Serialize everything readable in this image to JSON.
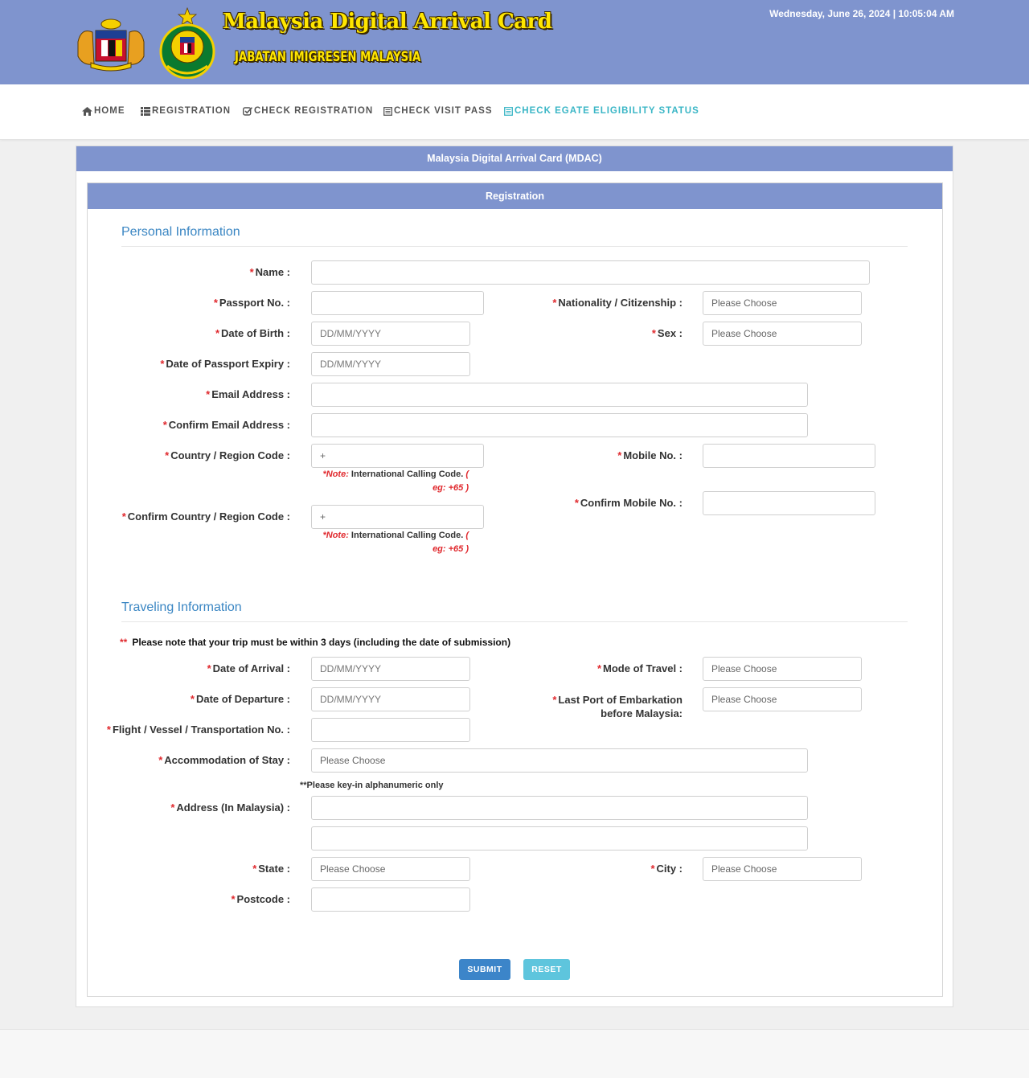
{
  "header": {
    "title": "Malaysia Digital Arrival Card",
    "subtitle": "JABATAN IMIGRESEN MALAYSIA",
    "datetime": "Wednesday, June 26, 2024 | 10:05:04 AM",
    "background_color": "#7f94ce",
    "emblems": [
      "coat-of-arms-emblem",
      "immigration-emblem"
    ]
  },
  "nav": {
    "items": [
      {
        "label": "HOME",
        "icon": "home-icon"
      },
      {
        "label": "REGISTRATION",
        "icon": "list-icon"
      },
      {
        "label": "CHECK REGISTRATION",
        "icon": "check-square-icon"
      },
      {
        "label": "CHECK VISIT PASS",
        "icon": "document-icon"
      },
      {
        "label": "CHECK EGATE ELIGIBILITY STATUS",
        "icon": "document-icon",
        "active": true
      }
    ],
    "active_color": "#3ab6c6"
  },
  "panel": {
    "title": "Malaysia Digital Arrival Card (MDAC)"
  },
  "form": {
    "title": "Registration",
    "personal": {
      "section_title": "Personal Information",
      "name": {
        "label": "Name :",
        "value": ""
      },
      "passport": {
        "label": "Passport No. :",
        "value": ""
      },
      "nationality": {
        "label": "Nationality / Citizenship :",
        "value": "Please Choose"
      },
      "dob": {
        "label": "Date of Birth :",
        "placeholder": "DD/MM/YYYY"
      },
      "sex": {
        "label": "Sex :",
        "value": "Please Choose"
      },
      "passport_expiry": {
        "label": "Date of Passport Expiry :",
        "placeholder": "DD/MM/YYYY"
      },
      "email": {
        "label": "Email Address :",
        "value": ""
      },
      "confirm_email": {
        "label": "Confirm Email Address :",
        "value": ""
      },
      "country_code": {
        "label": "Country / Region Code :",
        "value": "+"
      },
      "mobile": {
        "label": "Mobile No. :",
        "value": ""
      },
      "confirm_mobile": {
        "label": "Confirm Mobile No. :",
        "value": ""
      },
      "confirm_country_code": {
        "label": "Confirm Country / Region Code :",
        "value": "+"
      },
      "note": {
        "prefix": "*Note:",
        "text": "International Calling Code.",
        "paren_open": "(",
        "example": "eg: +65 )"
      }
    },
    "travel": {
      "section_title": "Traveling Information",
      "trip_note_marker": "**",
      "trip_note": "Please note that your trip must be within 3 days (including the date of submission)",
      "arrival": {
        "label": "Date of Arrival :",
        "placeholder": "DD/MM/YYYY"
      },
      "mode": {
        "label": "Mode of Travel :",
        "value": "Please Choose"
      },
      "departure": {
        "label": "Date of Departure :",
        "placeholder": "DD/MM/YYYY"
      },
      "last_port_line1": "Last Port of Embarkation",
      "last_port_line2": "before Malaysia:",
      "last_port_value": "Please Choose",
      "flight": {
        "label": "Flight / Vessel / Transportation No. :",
        "value": ""
      },
      "accommodation": {
        "label": "Accommodation of Stay :",
        "value": "Please Choose"
      },
      "alpha_note": "**Please key-in alphanumeric only",
      "address": {
        "label": "Address (In Malaysia) :",
        "line1": "",
        "line2": ""
      },
      "state": {
        "label": "State :",
        "value": "Please Choose"
      },
      "city": {
        "label": "City :",
        "value": "Please Choose"
      },
      "postcode": {
        "label": "Postcode :",
        "value": ""
      }
    },
    "buttons": {
      "submit": "SUBMIT",
      "reset": "RESET"
    },
    "required_marker": "*"
  }
}
